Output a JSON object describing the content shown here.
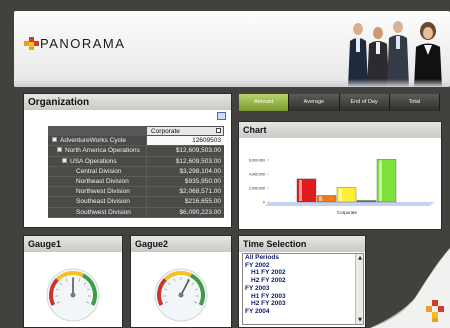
{
  "header": {
    "logo_text": "PANORAMA"
  },
  "organization": {
    "title": "Organization",
    "column_header": "Corporate",
    "rows": [
      {
        "label": "AdventureWorks Cycle",
        "value": "12609503",
        "indent": 0,
        "expand": true,
        "light": true
      },
      {
        "label": "North America Operations",
        "value": "$12,609,503.00",
        "indent": 1,
        "expand": true,
        "light": false
      },
      {
        "label": "USA Operations",
        "value": "$12,609,503.00",
        "indent": 2,
        "expand": true,
        "light": false
      },
      {
        "label": "Central Division",
        "value": "$3,298,104.00",
        "indent": 3,
        "expand": false,
        "light": false
      },
      {
        "label": "Northeast Division",
        "value": "$935,950.00",
        "indent": 3,
        "expand": false,
        "light": false
      },
      {
        "label": "Northwest Division",
        "value": "$2,068,571.00",
        "indent": 3,
        "expand": false,
        "light": false
      },
      {
        "label": "Southeast Division",
        "value": "$216,655.00",
        "indent": 3,
        "expand": false,
        "light": false
      },
      {
        "label": "Southwest Division",
        "value": "$6,090,223.00",
        "indent": 3,
        "expand": false,
        "light": false
      }
    ]
  },
  "tabs": [
    {
      "label": "Amount",
      "active": true
    },
    {
      "label": "Average",
      "active": false
    },
    {
      "label": "End of Day",
      "active": false
    },
    {
      "label": "Total",
      "active": false
    }
  ],
  "chart": {
    "title": "Chart",
    "chart_data": {
      "type": "bar",
      "categories": [
        "Corporate"
      ],
      "series": [
        {
          "values": [
            3298104
          ],
          "color": "#e01b1b"
        },
        {
          "values": [
            935950
          ],
          "color": "#f07a1e"
        },
        {
          "values": [
            2068571
          ],
          "color": "#ffee33"
        },
        {
          "values": [
            216655
          ],
          "color": "#2e9a3a"
        },
        {
          "values": [
            6090223
          ],
          "color": "#7fe03a"
        }
      ],
      "ytick_labels": [
        "6,000,000",
        "4,000,000",
        "2,000,000",
        "0"
      ],
      "ylim": [
        0,
        6000000
      ],
      "xlabel": "Corporate"
    }
  },
  "gauges": [
    {
      "title": "Gauge1",
      "value_fraction": 0.5
    },
    {
      "title": "Gague2",
      "value_fraction": 0.62
    }
  ],
  "time_selection": {
    "title": "Time Selection",
    "items": [
      {
        "label": "All Periods",
        "level": 1
      },
      {
        "label": "FY 2002",
        "level": 1
      },
      {
        "label": "H1 FY 2002",
        "level": 2
      },
      {
        "label": "H2 FY 2002",
        "level": 2
      },
      {
        "label": "FY 2003",
        "level": 1
      },
      {
        "label": "H1 FY 2003",
        "level": 2
      },
      {
        "label": "H2 FY 2003",
        "level": 2
      },
      {
        "label": "FY 2004",
        "level": 1
      }
    ]
  },
  "colors": {
    "accent_green": "#8fae3a",
    "logo_orange": "#f29b1f",
    "logo_red": "#d63a2b",
    "list_text": "#0d1a66"
  }
}
